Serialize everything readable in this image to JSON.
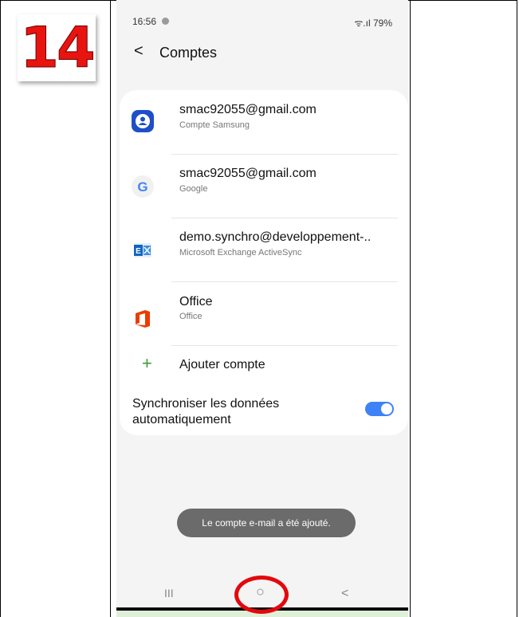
{
  "step_number": "14",
  "status_bar": {
    "time": "16:56",
    "battery": "79%",
    "signal_text": "ᯤ.ıl 79%"
  },
  "header": {
    "back_symbol": "<",
    "title": "Comptes"
  },
  "accounts": [
    {
      "name": "smac92055@gmail.com",
      "type": "Compte Samsung",
      "icon": "samsung-account-icon"
    },
    {
      "name": "smac92055@gmail.com",
      "type": "Google",
      "icon": "google-icon"
    },
    {
      "name": "demo.synchro@developpement-..",
      "type": "Microsoft Exchange ActiveSync",
      "icon": "exchange-icon"
    },
    {
      "name": "Office",
      "type": "Office",
      "icon": "office-icon"
    }
  ],
  "add_account": {
    "symbol": "+",
    "label": "Ajouter compte"
  },
  "sync": {
    "label": "Synchroniser les données automatiquement",
    "enabled": true
  },
  "toast": "Le compte e-mail a été ajouté.",
  "navbar": {
    "recent": "III",
    "home": "○",
    "back": "<"
  },
  "colors": {
    "step_red": "#e8140f",
    "toggle_blue": "#3e82f7",
    "highlight_ring": "#e3080c"
  }
}
